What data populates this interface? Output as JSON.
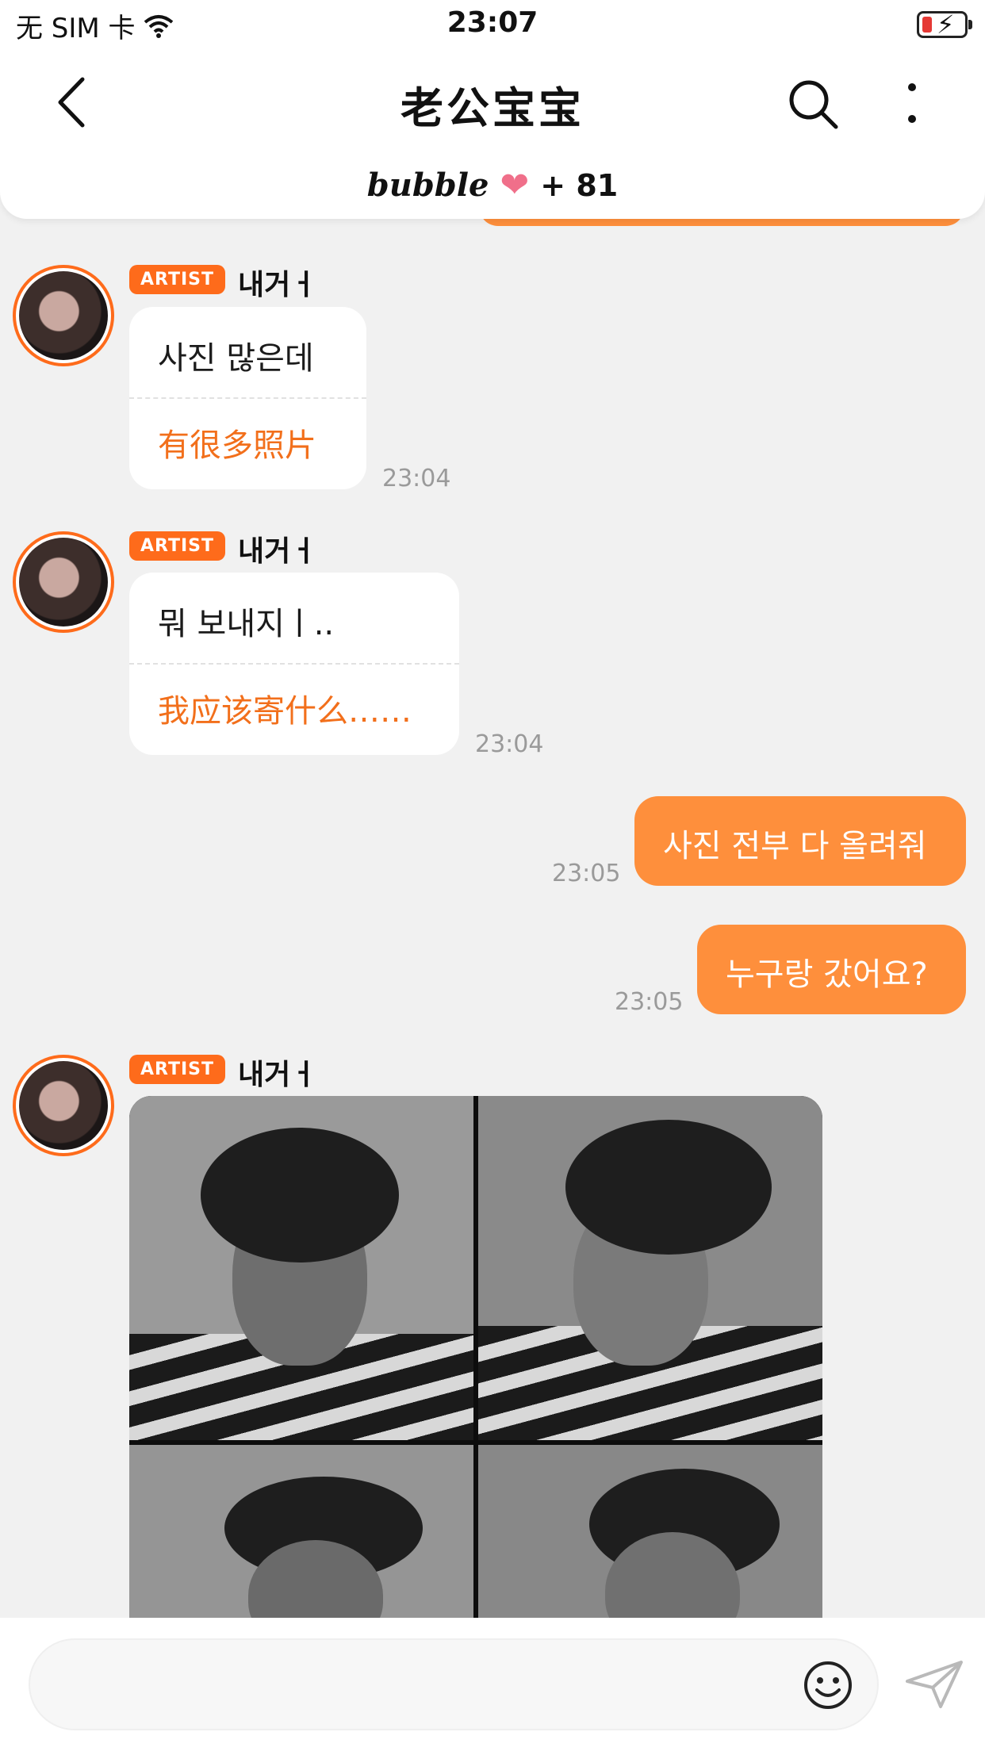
{
  "status_bar": {
    "carrier": "无 SIM 卡",
    "time": "23:07"
  },
  "header": {
    "title": "老公宝宝",
    "brand": "bubble",
    "heart": "❤",
    "member_count": "+ 81"
  },
  "messages": [
    {
      "badge": "ARTIST",
      "sender": "내거ㅓ",
      "korean": "사진 많은데",
      "chinese": "有很多照片",
      "time": "23:04"
    },
    {
      "badge": "ARTIST",
      "sender": "내거ㅓ",
      "korean": "뭐 보내지ㅣ..",
      "chinese": "我应该寄什么……",
      "time": "23:04"
    },
    {
      "text": "사진 전부 다 올려줘",
      "time": "23:05"
    },
    {
      "text": "누구랑 갔어요?",
      "time": "23:05"
    },
    {
      "badge": "ARTIST",
      "sender": "내거ㅓ"
    }
  ],
  "icons": {
    "back": "chevron-left-icon",
    "search": "search-icon",
    "more": "more-vertical-icon",
    "emoji": "emoji-icon",
    "send": "send-icon",
    "wifi": "wifi-icon",
    "battery": "battery-charging-icon"
  },
  "colors": {
    "accent": "#fe6b1b",
    "outgoing_bubble": "#fe8f3c",
    "translation_text": "#f26f1b",
    "background": "#f1f1f1"
  }
}
